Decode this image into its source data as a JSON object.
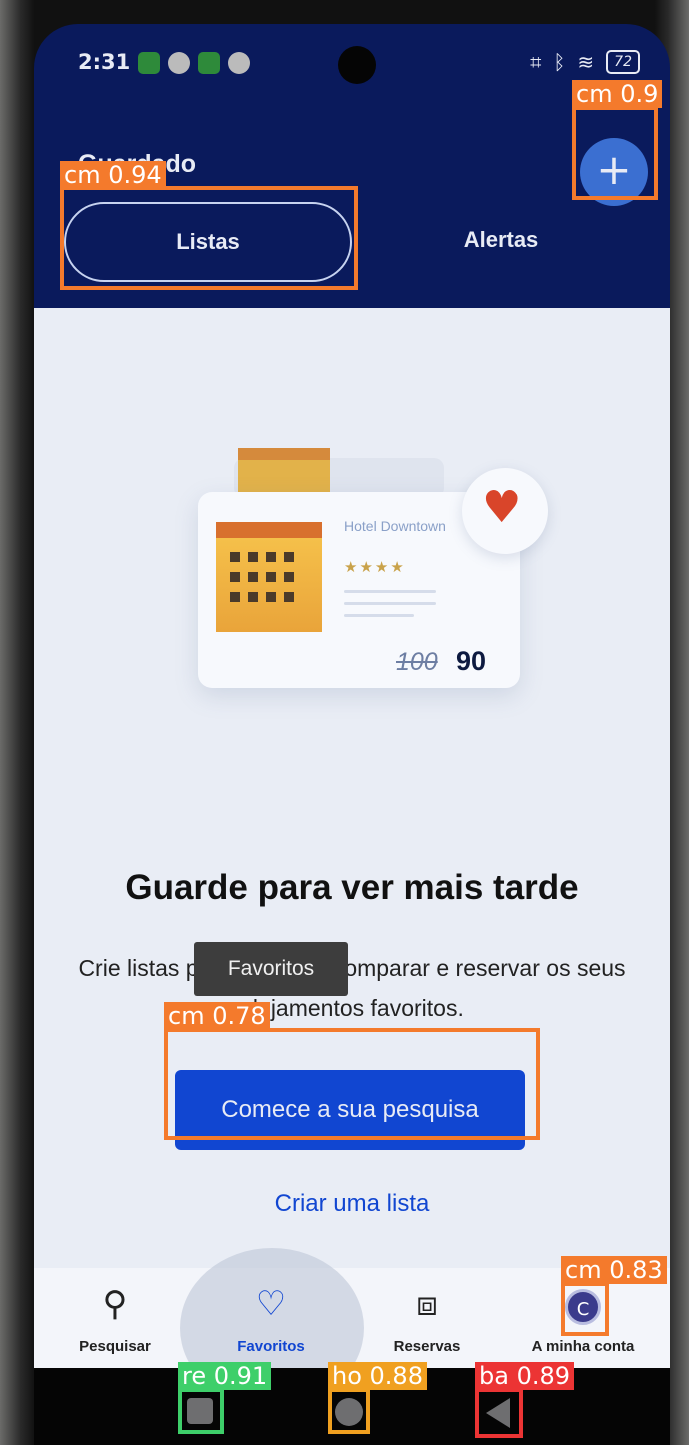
{
  "status_bar": {
    "time": "2:31",
    "battery": "72"
  },
  "header": {
    "title": "Guardado",
    "add_icon": "plus-icon"
  },
  "tabs": [
    {
      "label": "Listas",
      "selected": true
    },
    {
      "label": "Alertas",
      "selected": false
    }
  ],
  "illustration": {
    "hotel_name": "Hotel Downtown",
    "stars": "★★★★",
    "old_price": "100",
    "new_price": "90",
    "icon": "heart-icon"
  },
  "empty_state": {
    "headline": "Guarde para ver mais tarde",
    "description": "Crie listas para partilhar, comparar e reservar os seus alojamentos favoritos.",
    "primary_button": "Comece a sua pesquisa",
    "secondary_link": "Criar uma lista"
  },
  "tooltip": "Favoritos",
  "bottom_nav": [
    {
      "label": "Pesquisar",
      "icon": "search-icon",
      "active": false
    },
    {
      "label": "Favoritos",
      "icon": "heart-icon",
      "active": true
    },
    {
      "label": "Reservas",
      "icon": "briefcase-icon",
      "active": false
    },
    {
      "label": "A minha conta",
      "icon": "avatar",
      "avatar_letter": "C",
      "active": false
    }
  ],
  "detections": [
    {
      "label": "cm 0.9",
      "color": "#f47a2c"
    },
    {
      "label": "cm 0.94",
      "color": "#f47a2c"
    },
    {
      "label": "cm 0.78",
      "color": "#f47a2c"
    },
    {
      "label": "cm 0.83",
      "color": "#f47a2c"
    },
    {
      "label": "re 0.91",
      "color": "#3ecf6a"
    },
    {
      "label": "ho 0.88",
      "color": "#f0a020"
    },
    {
      "label": "ba 0.89",
      "color": "#ec3434"
    }
  ],
  "colors": {
    "brand_dark": "#0a1a5c",
    "accent": "#1146d1",
    "heart": "#d9452a"
  }
}
